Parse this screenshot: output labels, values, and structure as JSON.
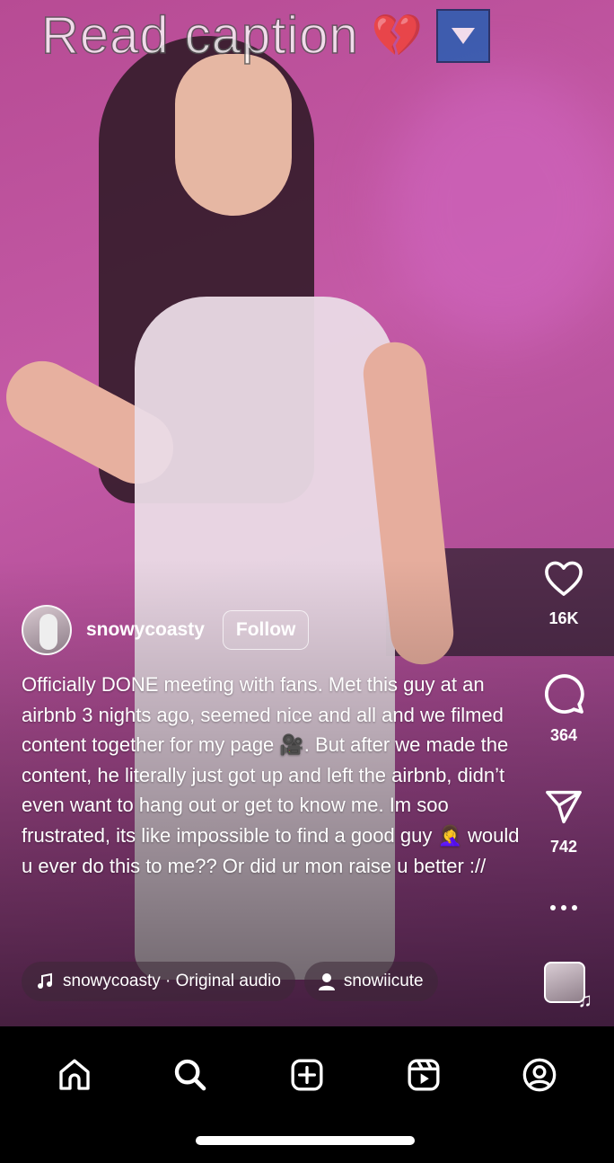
{
  "overlay": {
    "headline": "Read caption",
    "heart_emoji": "💔"
  },
  "post": {
    "username": "snowycoasty",
    "follow_label": "Follow",
    "caption": "Officially DONE meeting with fans. Met this guy at an airbnb 3 nights ago, seemed nice and all and we filmed content together for my page 🎥. But after we made the content, he literally just got up and left the airbnb, didn’t even want to hang out or get to know me. Im soo frustrated, its like impossible to find a good guy 🤦‍♀️ would u ever do this to me?? Or did ur mon raise u better ://"
  },
  "actions": {
    "likes": "16K",
    "comments": "364",
    "shares": "742"
  },
  "audio": {
    "label": "snowycoasty · Original audio",
    "tagged_user": "snowiicute"
  },
  "nav": {
    "items": [
      "home-icon",
      "search-icon",
      "create-icon",
      "reels-icon",
      "profile-icon"
    ]
  }
}
